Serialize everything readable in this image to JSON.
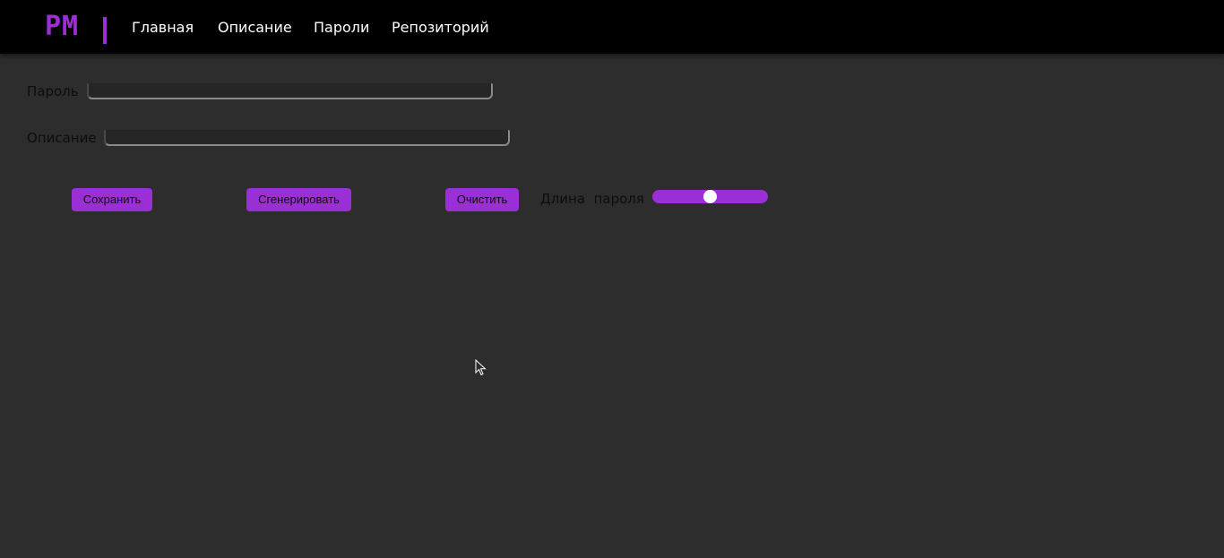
{
  "brand": {
    "logo_text": "PM",
    "accent_color": "#9b2fd6"
  },
  "nav": {
    "items": [
      {
        "label": "Главная"
      },
      {
        "label": "Описание"
      },
      {
        "label": "Пароли"
      },
      {
        "label": "Репозиторий"
      }
    ]
  },
  "form": {
    "password_label": "Пароль",
    "password_value": "",
    "description_label": "Описание",
    "description_value": ""
  },
  "actions": {
    "save_label": "Сохранить",
    "generate_label": "Сгенерировать",
    "clear_label": "Очистить"
  },
  "length": {
    "label": "Длина  пароля",
    "slider_fraction": 0.5
  },
  "icons": {
    "cursor": "mouse-pointer-icon"
  }
}
